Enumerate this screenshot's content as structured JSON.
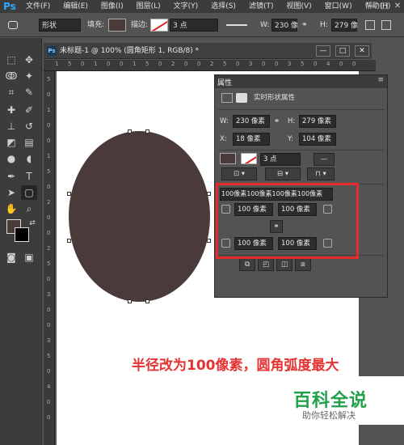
{
  "app": {
    "logo": "Ps",
    "menus": [
      "文件(F)",
      "编辑(E)",
      "图像(I)",
      "图层(L)",
      "文字(Y)",
      "选择(S)",
      "滤镜(T)",
      "视图(V)",
      "窗口(W)",
      "帮助(H)"
    ],
    "window_controls": [
      "—",
      "□",
      "✕"
    ]
  },
  "options_bar": {
    "mode": "形状",
    "fill_label": "填充:",
    "stroke_label": "描边:",
    "stroke_width": "3 点",
    "w_label": "W:",
    "w_value": "230 像",
    "h_label": "H:",
    "h_value": "279 像"
  },
  "document": {
    "tab_icon": "Ps",
    "title": "未标题-1 @ 100% (圆角矩形 1, RGB/8) *",
    "controls": [
      "—",
      "□",
      "✕"
    ],
    "ruler_top_marks": [
      "1",
      "5",
      "0",
      "1",
      "0",
      "0",
      "1",
      "5",
      "0",
      "2",
      "0",
      "0",
      "2",
      "5",
      "0",
      "3",
      "0",
      "0",
      "3",
      "5",
      "0",
      "4",
      "0",
      "0"
    ],
    "ruler_left_marks": [
      "5",
      "0",
      "1",
      "0",
      "0",
      "1",
      "5",
      "0",
      "2",
      "0",
      "0",
      "2",
      "5",
      "0",
      "3",
      "0",
      "0",
      "3",
      "5",
      "0",
      "4",
      "0",
      "0"
    ],
    "shape_color": "#4a3b3a"
  },
  "properties": {
    "tab": "属性",
    "title": "实时形状属性",
    "w_label": "W:",
    "w_value": "230 像素",
    "h_label": "H:",
    "h_value": "279 像素",
    "x_label": "X:",
    "x_value": "18 像素",
    "y_label": "Y:",
    "y_value": "104 像素",
    "stroke_width": "3 点",
    "corner_all": "100像素100像素100像素100像素",
    "corner_tl": "100 像素",
    "corner_tr": "100 像素",
    "corner_bl": "100 像素",
    "corner_br": "100 像素"
  },
  "annotation": {
    "prefix": "半径改为",
    "number": "100",
    "suffix": "像素，圆角弧度最大",
    "color": "#e53333"
  },
  "watermark": {
    "title": "百科全说",
    "subtitle": "助你轻松解决",
    "color": "#21a04a"
  }
}
